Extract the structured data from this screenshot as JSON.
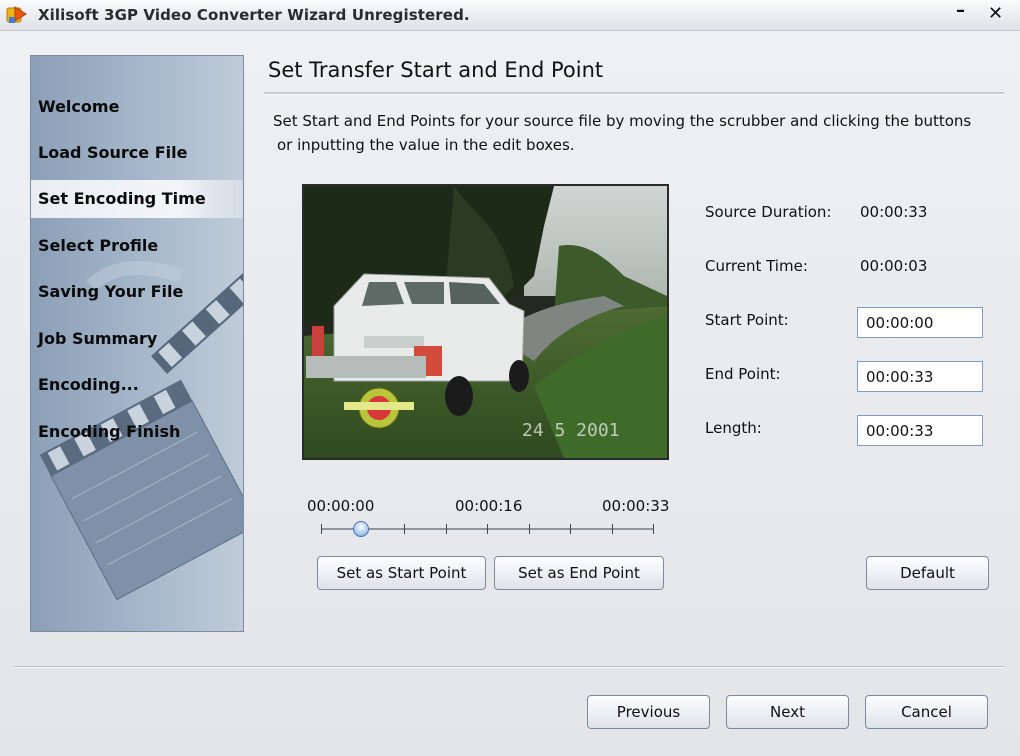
{
  "window": {
    "title": "Xilisoft 3GP Video Converter Wizard Unregistered.",
    "minimize_glyph": "–",
    "close_glyph": "✕"
  },
  "sidebar": {
    "steps": [
      {
        "label": "Welcome"
      },
      {
        "label": "Load Source File"
      },
      {
        "label": "Set Encoding Time",
        "active": true
      },
      {
        "label": "Select Profile"
      },
      {
        "label": "Saving Your File"
      },
      {
        "label": "Job Summary"
      },
      {
        "label": "Encoding..."
      },
      {
        "label": "Encoding Finish"
      }
    ]
  },
  "main": {
    "title": "Set Transfer Start and End Point",
    "description_line1": "Set Start and End Points for your source file by moving the scrubber and clicking the buttons",
    "description_line2": "or inputting the value in the edit boxes.",
    "video": {
      "timestamp_overlay": "24  5 2001"
    },
    "scrubber": {
      "start_label": "00:00:00",
      "mid_label": "00:00:16",
      "end_label": "00:00:33",
      "position_fraction": 0.12
    },
    "info": {
      "source_duration_label": "Source Duration:",
      "source_duration_value": "00:00:33",
      "current_time_label": "Current Time:",
      "current_time_value": "00:00:03",
      "start_point_label": "Start Point:",
      "start_point_value": "00:00:00",
      "end_point_label": "End Point:",
      "end_point_value": "00:00:33",
      "length_label": "Length:",
      "length_value": "00:00:33"
    },
    "buttons": {
      "set_start": "Set as Start Point",
      "set_end": "Set as End Point",
      "default": "Default"
    }
  },
  "footer": {
    "previous": "Previous",
    "next": "Next",
    "cancel": "Cancel"
  }
}
